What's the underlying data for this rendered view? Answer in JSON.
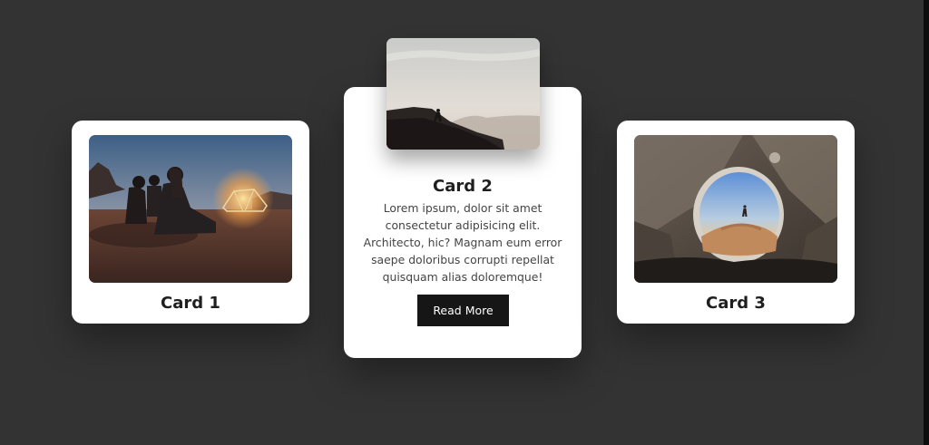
{
  "cards": [
    {
      "title": "Card 1",
      "image": "people-by-campfire-at-dusk-photo"
    },
    {
      "title": "Card 2",
      "image": "hiker-on-misty-ridge-photo",
      "text": "Lorem ipsum, dolor sit amet consectetur adipisicing elit. Architecto, hic? Magnam eum error saepe doloribus corrupti repellat quisquam alias doloremque!",
      "button_label": "Read More"
    },
    {
      "title": "Card 3",
      "image": "view-from-tent-door-photo"
    }
  ],
  "colors": {
    "background": "#333333",
    "card": "#ffffff",
    "button": "#161616",
    "title_text": "#1f1f1f"
  }
}
